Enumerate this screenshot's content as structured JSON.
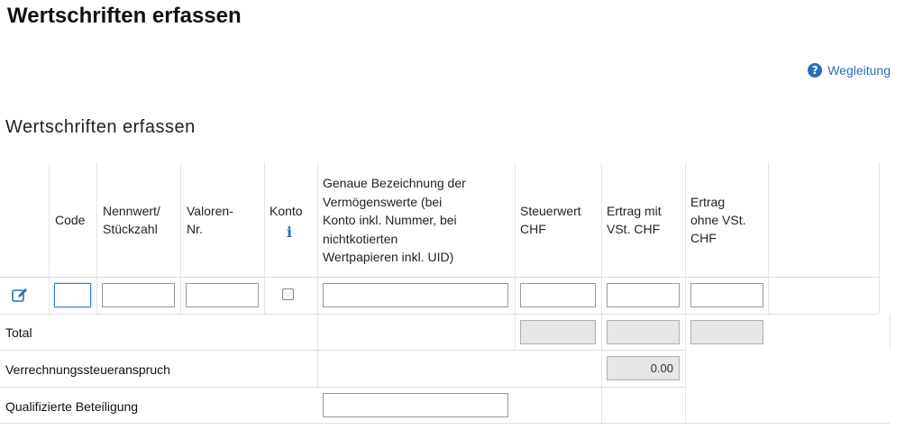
{
  "page": {
    "title": "Wertschriften erfassen"
  },
  "help": {
    "label": "Wegleitung",
    "icon": "question-circle-icon",
    "color": "#2a6ebb"
  },
  "section": {
    "title": "Wertschriften erfassen"
  },
  "table": {
    "columns": [
      {
        "key": "code",
        "label": "Code"
      },
      {
        "key": "nennwert",
        "label": "Nennwert/\nStückzahl"
      },
      {
        "key": "valoren",
        "label": "Valoren-\nNr."
      },
      {
        "key": "konto",
        "label": "Konto"
      },
      {
        "key": "bezeichnung",
        "label": "Genaue Bezeichnung der\nVermögenswerte (bei\nKonto inkl. Nummer, bei\nnichtkotierten\nWertpapieren inkl. UID)"
      },
      {
        "key": "steuerwert",
        "label": "Steuerwert\nCHF"
      },
      {
        "key": "ertrag_mit",
        "label": "Ertrag mit\nVSt. CHF"
      },
      {
        "key": "ertrag_ohne",
        "label": "Ertrag\nohne VSt.\nCHF"
      }
    ],
    "entry_row": {
      "edit_icon": "pencil-edit-icon",
      "code": "",
      "nennwert": "",
      "valoren": "",
      "konto_checked": false,
      "bezeichnung": "",
      "steuerwert": "",
      "ertrag_mit": "",
      "ertrag_ohne": ""
    },
    "total": {
      "label": "Total",
      "steuerwert": "",
      "ertrag_mit": "",
      "ertrag_ohne": ""
    },
    "verrechnung": {
      "label": "Verrechnungssteueranspruch",
      "value": "0.00"
    },
    "beteiligung": {
      "label": "Qualifizierte Beteiligung",
      "value": ""
    }
  },
  "colors": {
    "accent": "#2a6ebb",
    "readonly_bg": "#e6e6e6",
    "focus_border": "#3a7fd0"
  }
}
